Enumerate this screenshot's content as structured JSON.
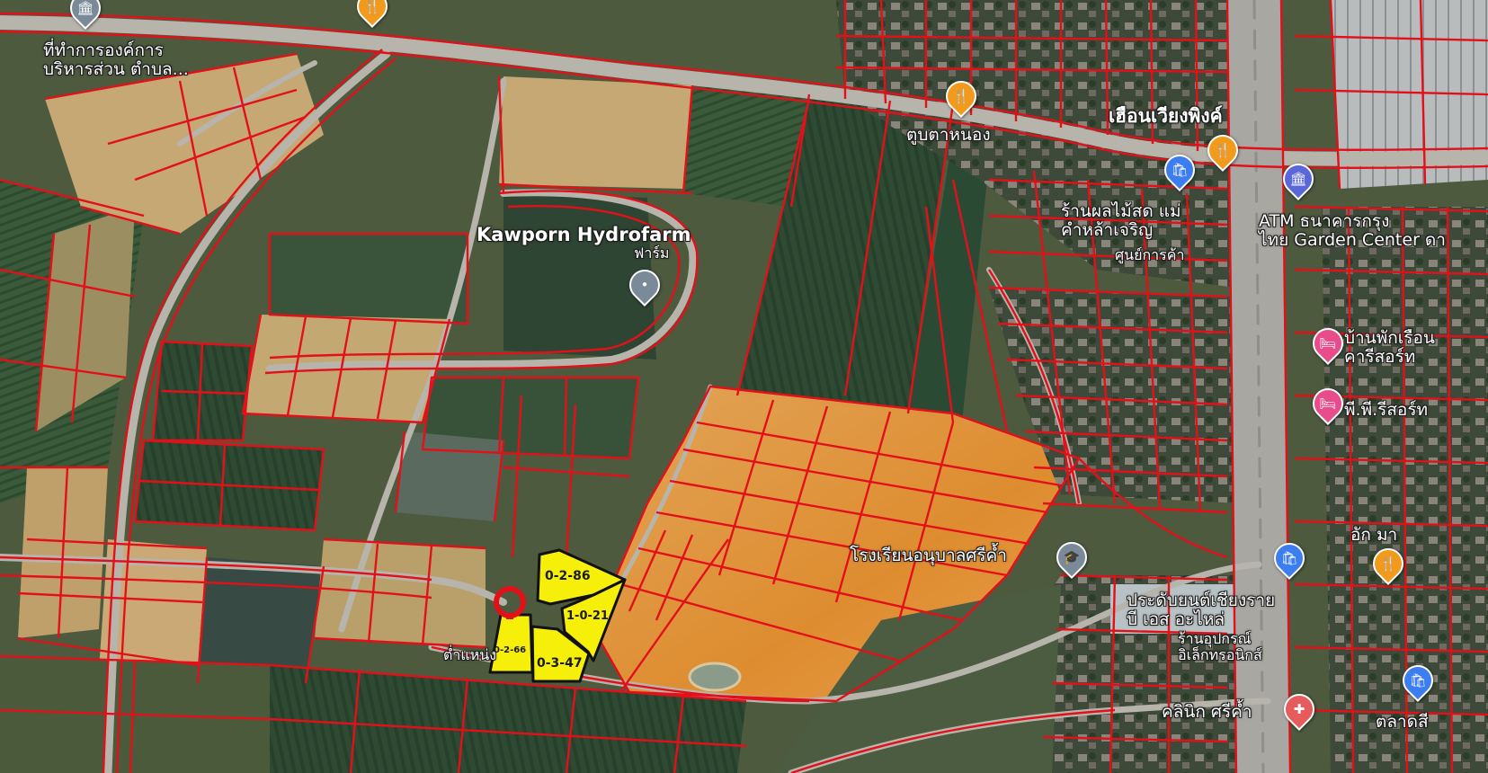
{
  "place_labels": [
    {
      "id": "sao-office",
      "text": "ที่ทำการองค์การ\nบริหารส่วน ตำบล...",
      "cls": ""
    },
    {
      "id": "tub-ta-nong",
      "text": "ตูบตาหนอง",
      "cls": ""
    },
    {
      "id": "huean-wiang",
      "text": "เฮือนเวียงพิงค์",
      "cls": "big"
    },
    {
      "id": "kawporn",
      "text": "Kawporn Hydrofarm",
      "cls": "big"
    },
    {
      "id": "kawporn-sub",
      "text": "ฟาร์ม",
      "cls": "sm"
    },
    {
      "id": "fruit-shop",
      "text": "ร้านผลไม้สด แม่\nคำหล้าเจริญ",
      "cls": ""
    },
    {
      "id": "shop-center",
      "text": "ศูนย์การค้า",
      "cls": "sm"
    },
    {
      "id": "atm",
      "text": "ATM ธนาคารกรุง\nไทย Garden Center ดา",
      "cls": ""
    },
    {
      "id": "resort-1",
      "text": "บ้านพักเรือน\nคารีสอร์ท",
      "cls": ""
    },
    {
      "id": "resort-2",
      "text": "พี.พี.รีสอร์ท",
      "cls": ""
    },
    {
      "id": "kindergarten",
      "text": "โรงเรียนอนุบาลศรีค้ำ",
      "cls": ""
    },
    {
      "id": "auto-parts",
      "text": "ประดับยนต์เชียงราย\nบี เอส อะไหล่",
      "cls": ""
    },
    {
      "id": "electronics",
      "text": "ร้านอุปกรณ์\nอิเล็กทรอนิกส์",
      "cls": "sm"
    },
    {
      "id": "clinic",
      "text": "คลินิก ศรีค้ำ",
      "cls": ""
    },
    {
      "id": "market",
      "text": "ตลาดสี",
      "cls": ""
    },
    {
      "id": "ak-ma",
      "text": "อัก มา",
      "cls": ""
    },
    {
      "id": "road-name",
      "text": "ต่ำแหน่ง",
      "cls": "sm"
    }
  ],
  "plots": [
    {
      "id": "plot-a",
      "area": "0-2-86"
    },
    {
      "id": "plot-b",
      "area": "1-0-21"
    },
    {
      "id": "plot-c",
      "area": "0-2-66"
    },
    {
      "id": "plot-d",
      "area": "0-3-47"
    }
  ],
  "pins": [
    {
      "id": "pin-food-1",
      "kind": "fork-knife-icon",
      "color": "#f29a1b"
    },
    {
      "id": "pin-food-2",
      "kind": "fork-knife-icon",
      "color": "#f29a1b"
    },
    {
      "id": "pin-food-3",
      "kind": "fork-knife-icon",
      "color": "#f29a1b"
    },
    {
      "id": "pin-food-4",
      "kind": "fork-knife-icon",
      "color": "#f29a1b"
    },
    {
      "id": "pin-shop",
      "kind": "shopping-bag-icon",
      "color": "#3c7df0"
    },
    {
      "id": "pin-shop-2",
      "kind": "shopping-bag-icon",
      "color": "#3c7df0"
    },
    {
      "id": "pin-shop-3",
      "kind": "shopping-bag-icon",
      "color": "#3c7df0"
    },
    {
      "id": "pin-bank",
      "kind": "bank-icon",
      "color": "#5a67d8"
    },
    {
      "id": "pin-hotel-1",
      "kind": "bed-icon",
      "color": "#e94c8b"
    },
    {
      "id": "pin-hotel-2",
      "kind": "bed-icon",
      "color": "#e94c8b"
    },
    {
      "id": "pin-school",
      "kind": "graduation-cap-icon",
      "color": "#7a8a99"
    },
    {
      "id": "pin-farm",
      "kind": "location-pin-icon",
      "color": "#7a8a99"
    },
    {
      "id": "pin-clinic",
      "kind": "medical-cross-icon",
      "color": "#e65b5b"
    },
    {
      "id": "pin-office",
      "kind": "government-building-icon",
      "color": "#7a8a99"
    }
  ],
  "colors": {
    "parcel_line": "#e3101a",
    "highlight_plot": "#f5ef0a",
    "orange_field": "#e8973a",
    "road": "#b7b4ac",
    "selected_marker": "#e3101a"
  }
}
